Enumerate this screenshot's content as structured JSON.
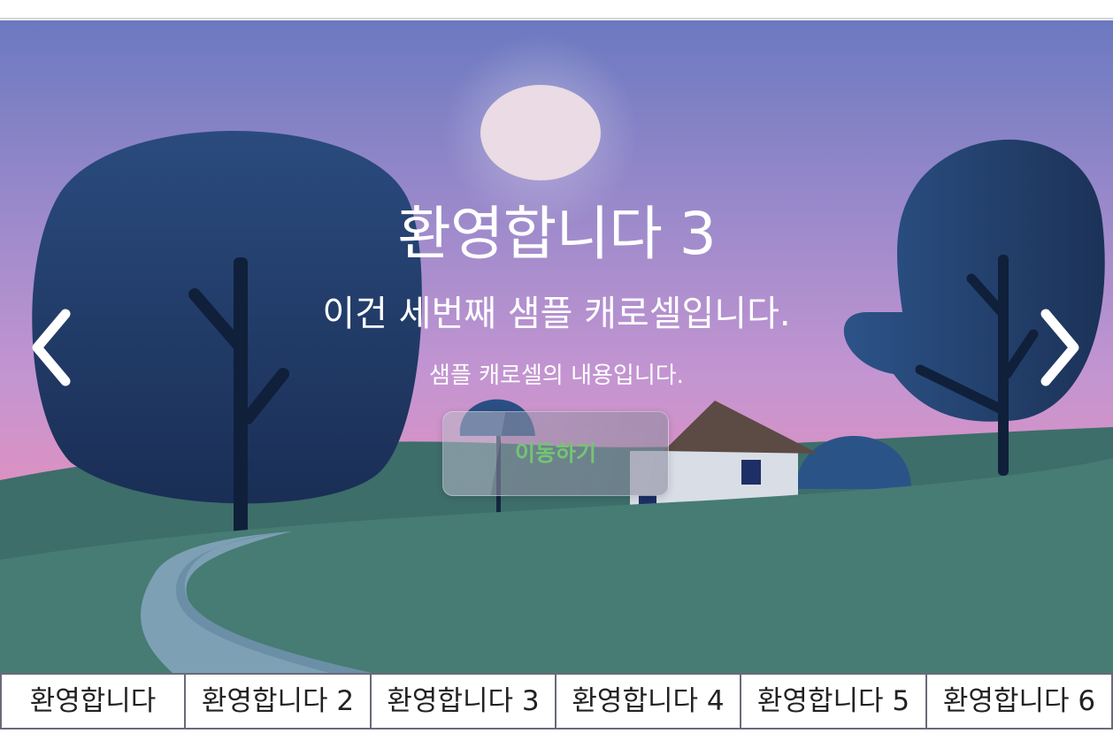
{
  "slide": {
    "title": "환영합니다 3",
    "subtitle": "이건 세번째 샘플 캐로셀입니다.",
    "description": "샘플 캐로셀의 내용입니다.",
    "button_label": "이동하기"
  },
  "tabs": [
    {
      "label": "환영합니다"
    },
    {
      "label": "환영합니다 2"
    },
    {
      "label": "환영합니다 3"
    },
    {
      "label": "환영합니다 4"
    },
    {
      "label": "환영합니다 5"
    },
    {
      "label": "환영합니다 6"
    }
  ],
  "icons": {
    "prev": "chevron-left-icon",
    "next": "chevron-right-icon"
  },
  "colors": {
    "sky_top": "#6b79c0",
    "sky_mid": "#b994d0",
    "sky_bottom": "#e28fbc",
    "hill": "#457d74",
    "tree": "#1e3a66",
    "button_text": "#74c474"
  }
}
